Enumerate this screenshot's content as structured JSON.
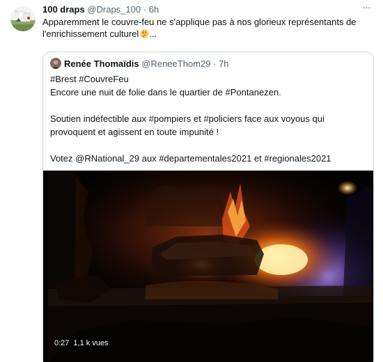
{
  "tweet": {
    "display_name": "100 draps",
    "handle": "@Draps_100",
    "separator": "·",
    "time": "6h",
    "more_label": "···",
    "text_line1": "Apparemment le couvre-feu ne s'applique pas à nos glorieux représentants de",
    "text_line2": "l'enrichissement culturel",
    "emoji_name": "thinking-face-icon"
  },
  "quote": {
    "display_name": "Renée Thomaïdis",
    "handle": "@ReneeThom29",
    "separator": "·",
    "time": "7h",
    "lines": {
      "line1_tag1": "#Brest",
      "line1_tag2": "#CouvreFeu",
      "line2_text": "Encore une nuit de folie dans le quartier de ",
      "line2_tag": "#Pontanezen",
      "line2_end": ".",
      "line3_text": "Soutien indéfectible aux ",
      "line3_tag1": "#pompiers",
      "line3_mid": " et ",
      "line3_tag2": "#policiers",
      "line3_end": " face aux voyous qui",
      "line4_text": "provoquent et agissent en toute impunité !",
      "line5_text": "Votez ",
      "line5_mention": "@RNational_29",
      "line5_mid1": " aux ",
      "line5_tag1": "#departementales2021",
      "line5_mid2": " et ",
      "line5_tag2": "#regionales2021"
    },
    "video": {
      "duration": "0:27",
      "views": "1,1 k vues"
    }
  },
  "colors": {
    "text_primary": "#0f1419",
    "text_secondary": "#536471",
    "border": "#cfd9de",
    "fire_orange": "#ff8a1c"
  }
}
